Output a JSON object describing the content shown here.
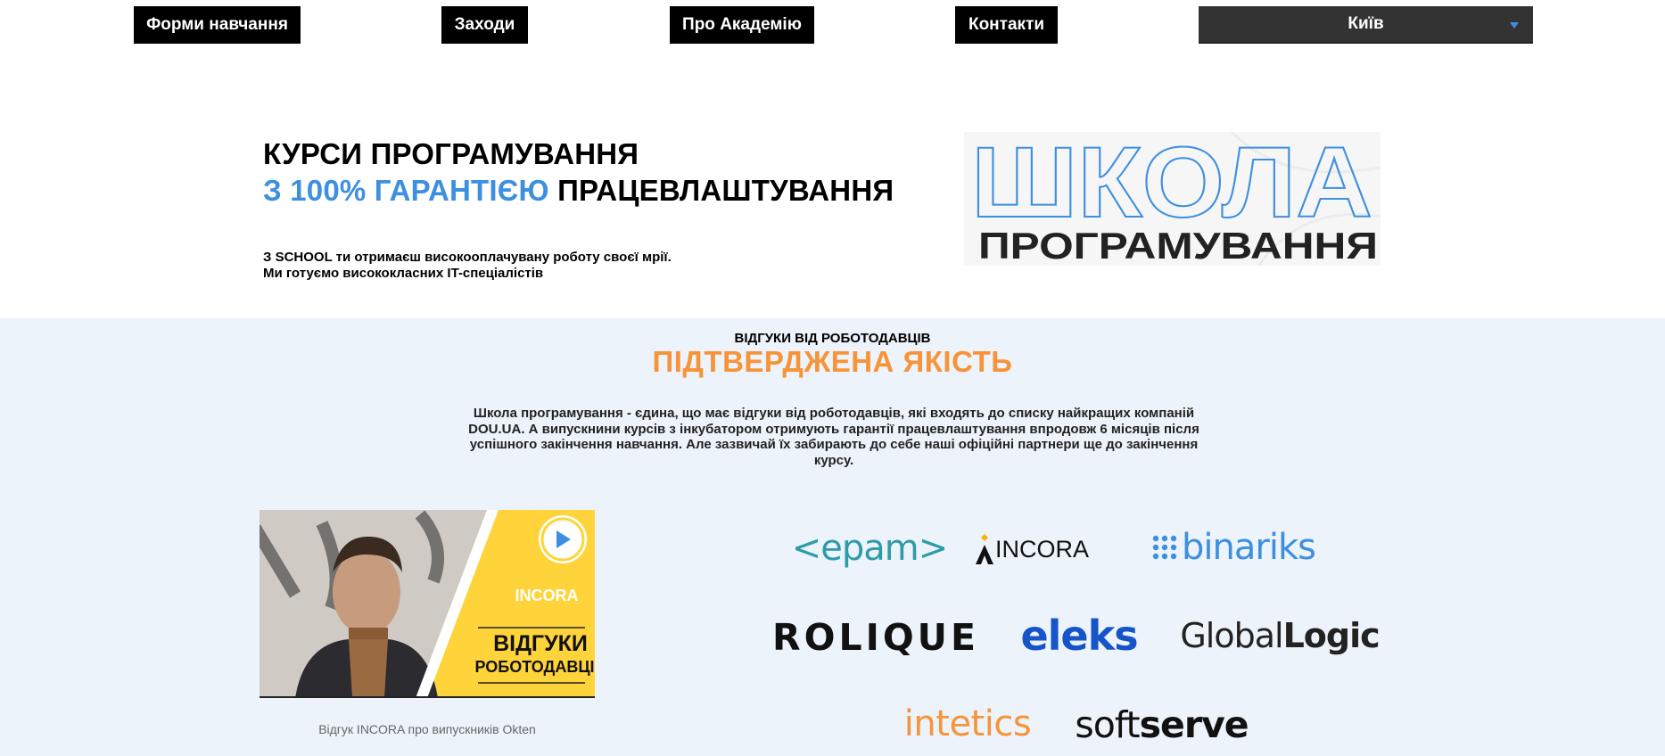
{
  "nav": {
    "items": [
      {
        "label": "Форми навчання"
      },
      {
        "label": "Заходи"
      },
      {
        "label": "Про Академію"
      },
      {
        "label": "Контакти"
      }
    ],
    "city": "Київ"
  },
  "hero": {
    "title_line1": "КУРСИ ПРОГРАМУВАННЯ",
    "title_accent": "З 100% ГАРАНТІЄЮ",
    "title_rest": "ПРАЦЕВЛАШТУВАННЯ",
    "subtitle_line1": "З SCHOOL ти отримаєш високооплачувану роботу своєї мрії.",
    "subtitle_line2": "Ми готуємо висококласних IT-спеціалістів",
    "logo_top": "ШКОЛА",
    "logo_bottom": "ПРОГРАМУВАННЯ"
  },
  "reviews": {
    "kicker": "ВІДГУКИ ВІД РОБОТОДАВЦІВ",
    "title": "ПІДТВЕРДЖЕНА ЯКІСТЬ",
    "description": "Школа програмування - єдина, що має відгуки від роботодавців, які входять до списку найкращих компаній DOU.UA. А випускнини курсів з інкубатором отримують гарантії працевлаштування впродовж 6 місяців після успішного закінчення навчання. Але зазвичай їх забирають до себе наші офіційні партнери ще до закінчення курсу.",
    "video": {
      "brand": "INCORA",
      "line1": "ВІДГУКИ",
      "line2": "РОБОТОДАВЦІВ",
      "caption": "Відгук INCORA про випускників Okten"
    },
    "partners": {
      "epam": "<epam>",
      "incora": "INCORA",
      "binariks": "binariks",
      "rolique": "ROLIQUE",
      "eleks": "eleks",
      "globallogic_a": "Global",
      "globallogic_b": "Logic",
      "intetics": "intetics",
      "softserve_a": "soft",
      "softserve_b": "serve"
    }
  },
  "colors": {
    "accent_blue": "#3d8fe0",
    "accent_orange": "#f7943a",
    "section_bg": "#edf3fa",
    "video_yellow": "#ffd43a"
  }
}
